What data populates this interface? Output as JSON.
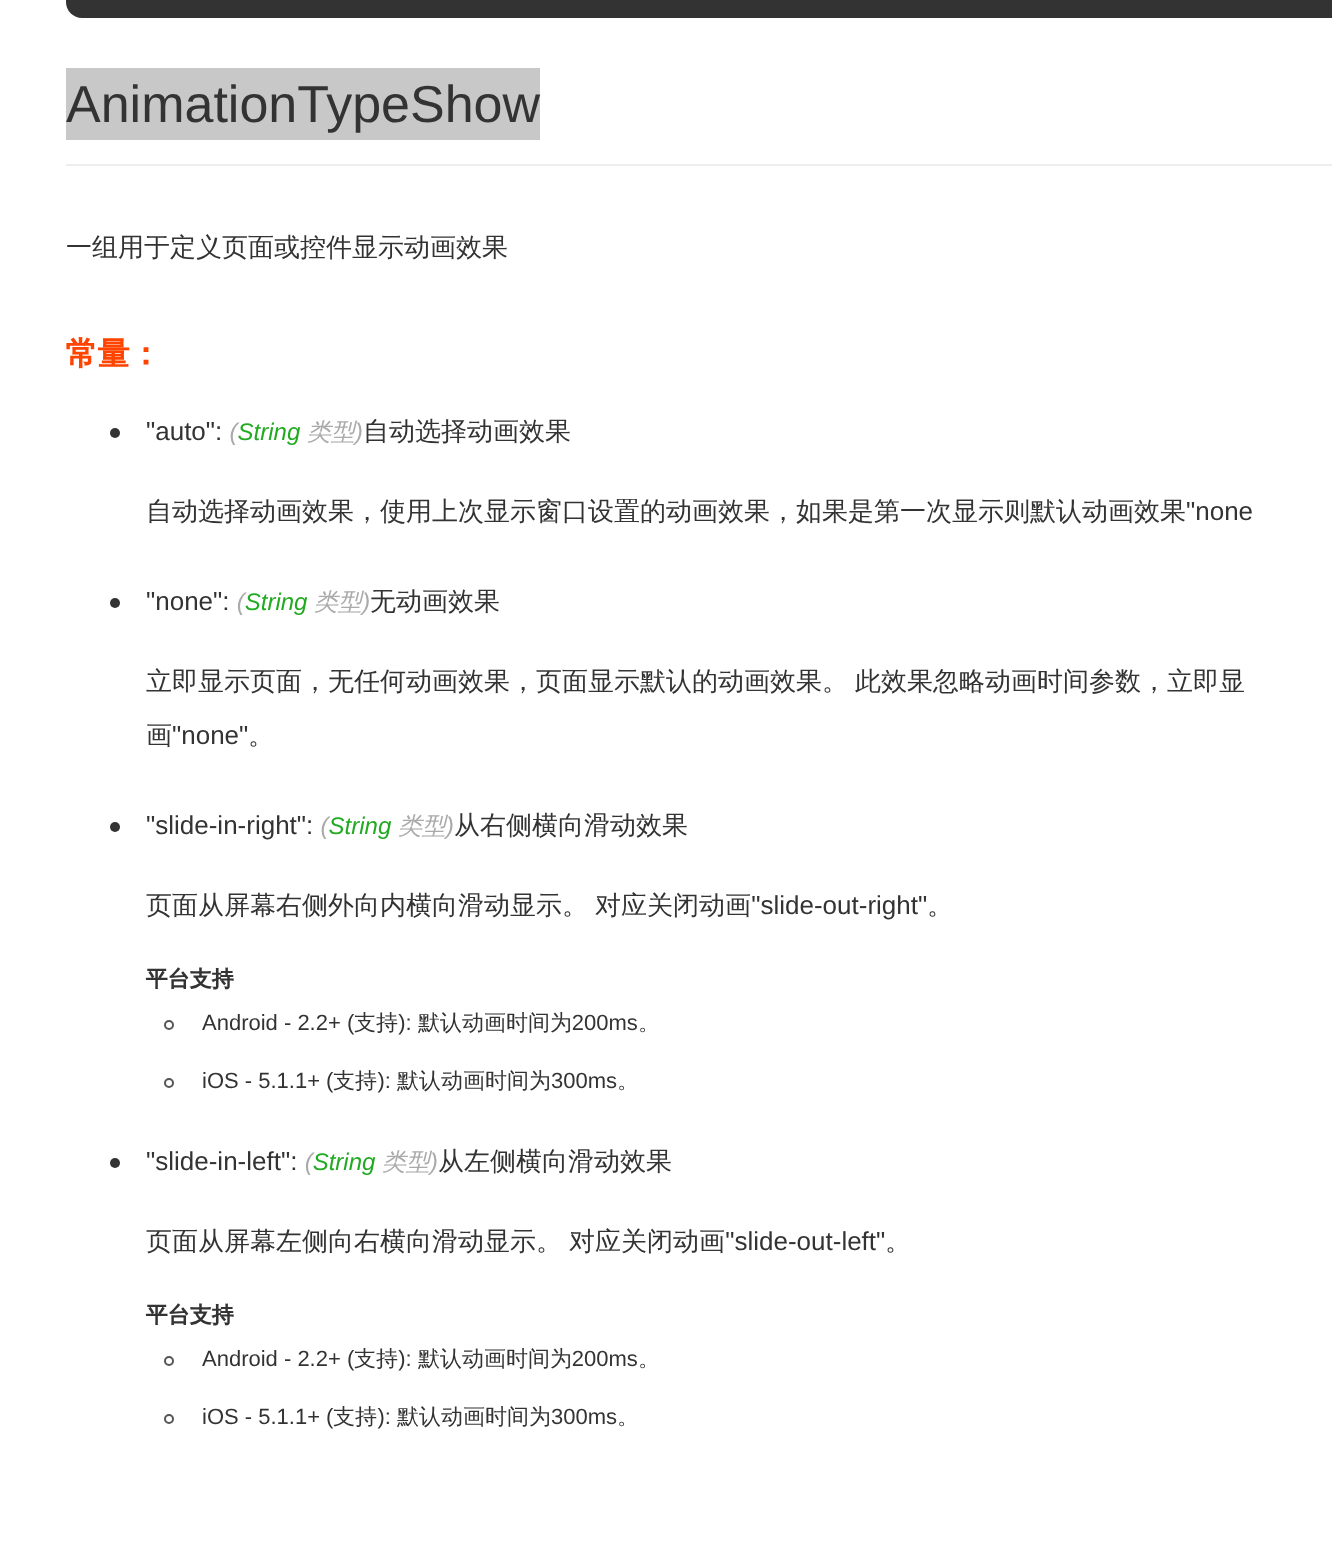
{
  "title": {
    "text": "AnimationTypeShow",
    "selected": true
  },
  "description": "一组用于定义页面或控件显示动画效果",
  "section_heading": "常量：",
  "constants": [
    {
      "name": "\"auto\": ",
      "type_open": "(",
      "type": "String",
      "type_close": " 类型)",
      "summary": "自动选择动画效果",
      "details": [
        "自动选择动画效果，使用上次显示窗口设置的动画效果，如果是第一次显示则默认动画效果\"none"
      ]
    },
    {
      "name": "\"none\": ",
      "type_open": "(",
      "type": "String",
      "type_close": " 类型)",
      "summary": "无动画效果",
      "details": [
        "立即显示页面，无任何动画效果，页面显示默认的动画效果。 此效果忽略动画时间参数，立即显",
        "画\"none\"。"
      ]
    },
    {
      "name": "\"slide-in-right\": ",
      "type_open": "(",
      "type": "String",
      "type_close": " 类型)",
      "summary": "从右侧横向滑动效果",
      "details": [
        "页面从屏幕右侧外向内横向滑动显示。 对应关闭动画\"slide-out-right\"。"
      ],
      "platform_heading": "平台支持",
      "platforms": [
        "Android - 2.2+ (支持): 默认动画时间为200ms。",
        "iOS - 5.1.1+ (支持): 默认动画时间为300ms。"
      ]
    },
    {
      "name": "\"slide-in-left\": ",
      "type_open": "(",
      "type": "String",
      "type_close": " 类型)",
      "summary": "从左侧横向滑动效果",
      "details": [
        "页面从屏幕左侧向右横向滑动显示。 对应关闭动画\"slide-out-left\"。"
      ],
      "platform_heading": "平台支持",
      "platforms": [
        "Android - 2.2+ (支持): 默认动画时间为200ms。",
        "iOS - 5.1.1+ (支持): 默认动画时间为300ms。"
      ]
    }
  ]
}
